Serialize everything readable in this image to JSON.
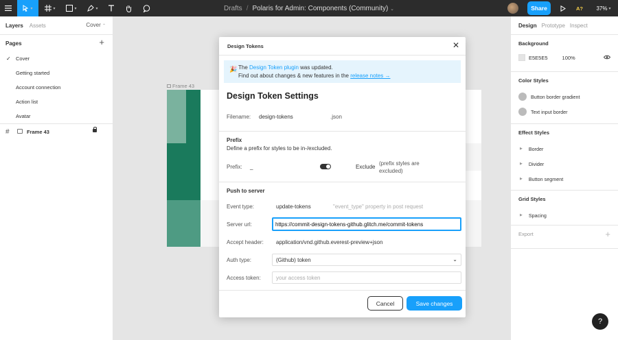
{
  "topbar": {
    "breadcrumb_drafts": "Drafts",
    "breadcrumb_sep": "/",
    "file_name": "Polaris for Admin: Components (Community)",
    "share_label": "Share",
    "ax_label": "A?",
    "zoom": "37%",
    "accent": "#18a0fb",
    "tools": [
      "menu-icon",
      "move-tool-icon",
      "frame-tool-icon",
      "shape-tool-icon",
      "pen-tool-icon",
      "text-tool-icon",
      "hand-tool-icon",
      "comment-tool-icon"
    ]
  },
  "left_panel": {
    "tab_layers": "Layers",
    "tab_assets": "Assets",
    "page_selector": "Cover",
    "pages_title": "Pages",
    "pages": [
      "Cover",
      "Getting started",
      "Account connection",
      "Action list",
      "Avatar"
    ],
    "layer_name": "Frame 43"
  },
  "canvas": {
    "frame_label": "Frame 43",
    "colors": {
      "green_light": "#7ab29e",
      "green_dark": "#1a7a5c",
      "green_mid": "#4e9b83"
    }
  },
  "modal": {
    "header": "Design Tokens",
    "notice_pre": "The ",
    "notice_link": "Design Token plugin",
    "notice_post": " was updated.",
    "notice_line2": "Find out about changes & new features in the ",
    "notice_link2": "release notes →",
    "title": "Design Token Settings",
    "filename_label": "Filename:",
    "filename_value": "design-tokens",
    "filename_ext": ".json",
    "prefix_title": "Prefix",
    "prefix_desc": "Define a prefix for styles to be in-/excluded.",
    "prefix_label": "Prefix:",
    "prefix_value": "_",
    "exclude_label": "Exclude",
    "exclude_note_1": "(prefix styles are",
    "exclude_note_2": "excluded)",
    "push_title": "Push to server",
    "event_type_label": "Event type:",
    "event_type_value": "update-tokens",
    "event_type_hint": "\"event_type\" property in post request",
    "server_url_label": "Server url:",
    "server_url_value": "https://commit-design-tokens-github.glitch.me/commit-tokens",
    "accept_header_label": "Accept header:",
    "accept_header_value": "application/vnd.github.everest-preview+json",
    "auth_type_label": "Auth type:",
    "auth_type_value": "(Github) token",
    "access_token_label": "Access token:",
    "access_token_placeholder": "your access token",
    "cancel_label": "Cancel",
    "save_label": "Save changes"
  },
  "right_panel": {
    "tab_design": "Design",
    "tab_prototype": "Prototype",
    "tab_inspect": "Inspect",
    "background_title": "Background",
    "bg_hex": "E5E5E5",
    "bg_opacity": "100%",
    "color_styles_title": "Color Styles",
    "color_styles": [
      "Button border gradient",
      "Text input border"
    ],
    "effect_styles_title": "Effect Styles",
    "effect_styles": [
      "Border",
      "Divider",
      "Button segment"
    ],
    "grid_styles_title": "Grid Styles",
    "grid_styles": [
      "Spacing"
    ],
    "export_title": "Export"
  },
  "help_label": "?"
}
